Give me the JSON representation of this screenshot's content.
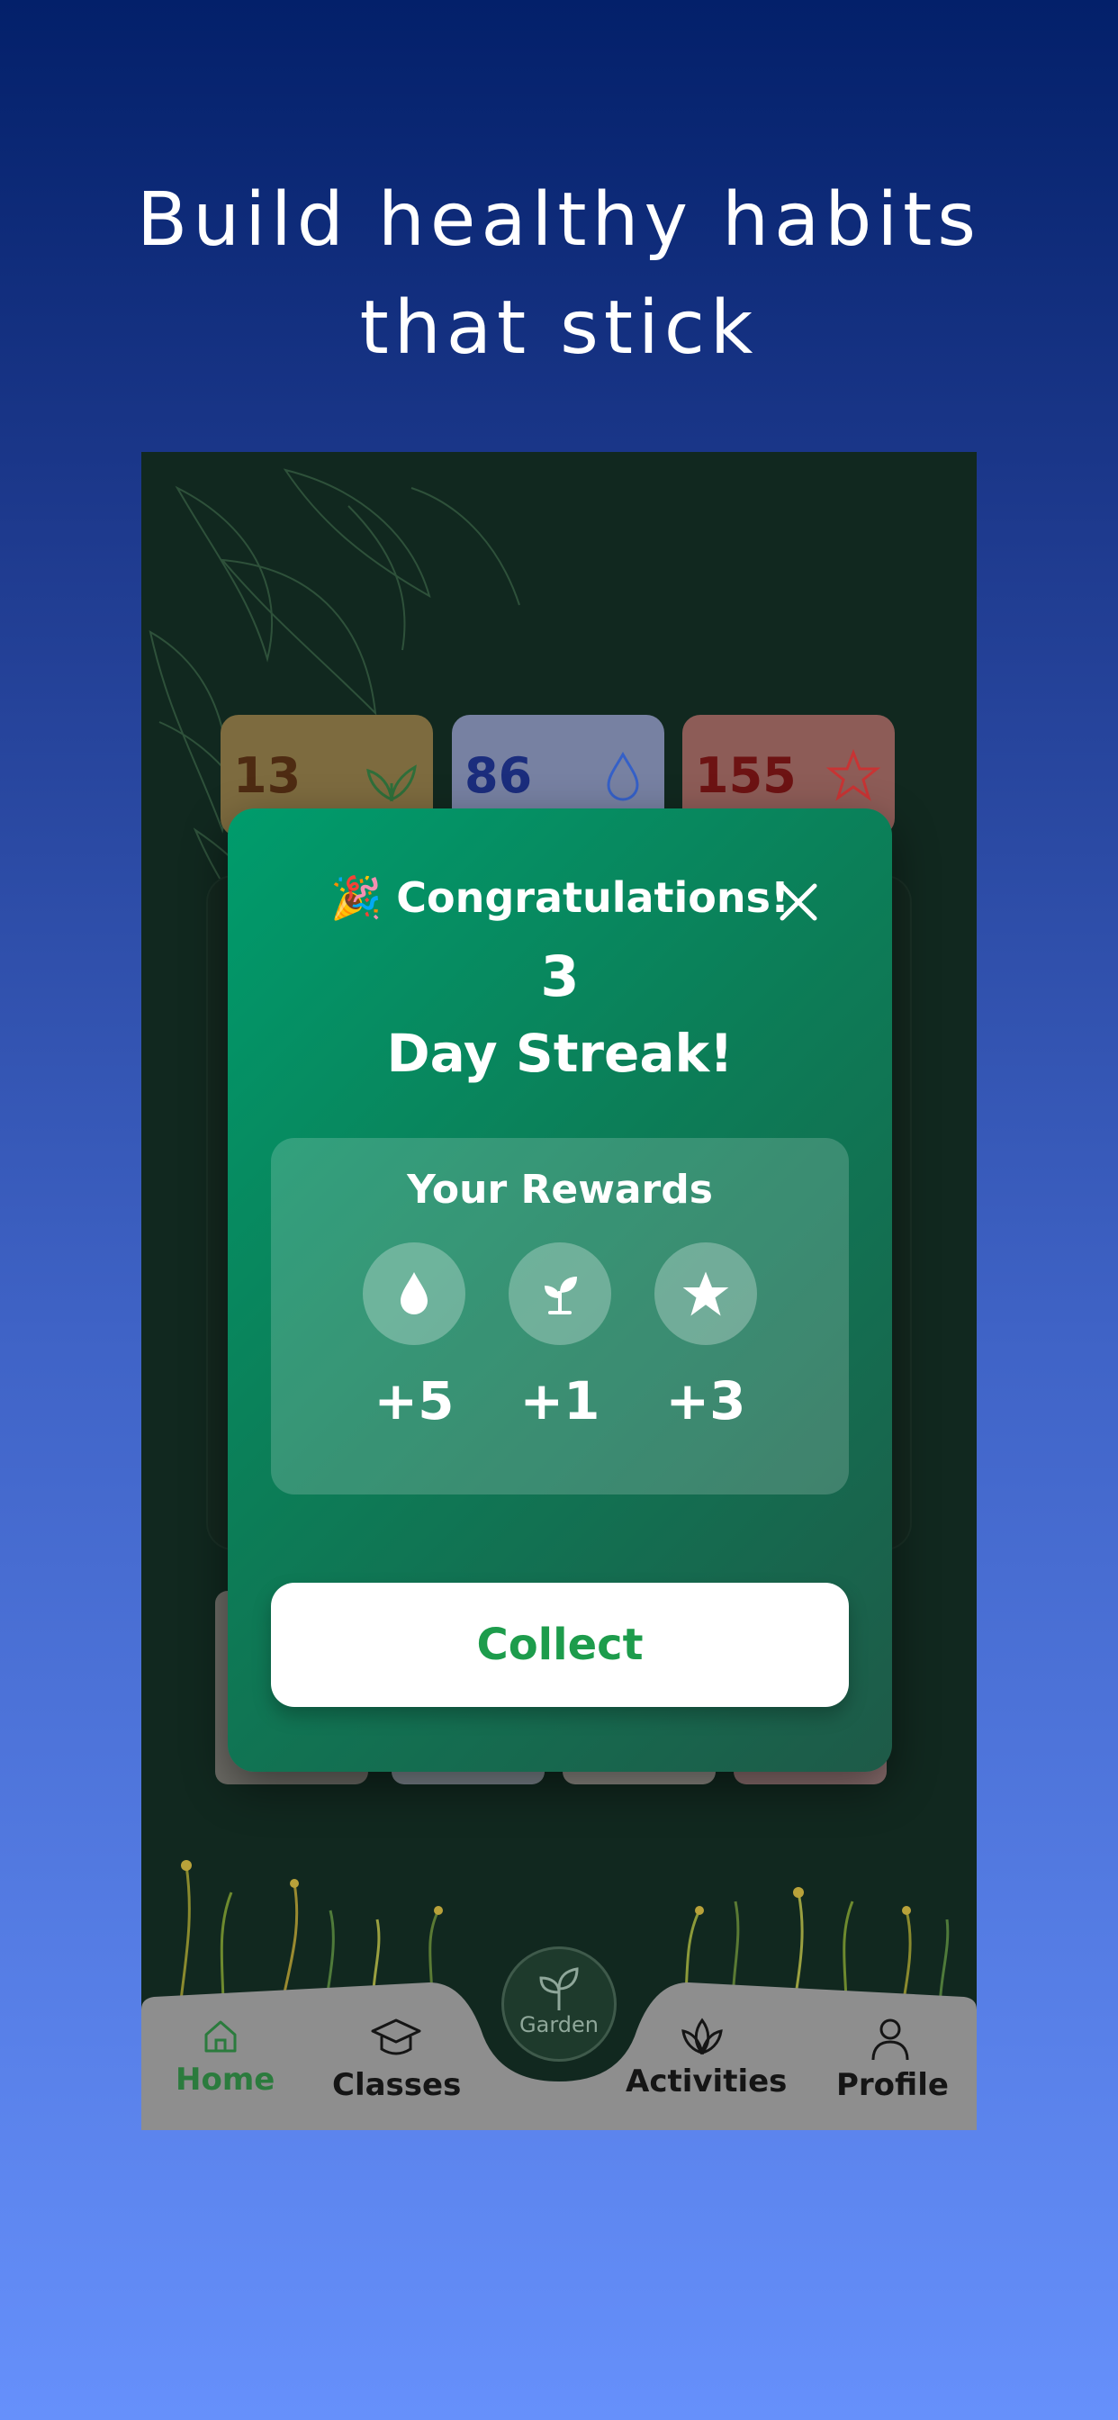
{
  "headline": {
    "line1": "Build healthy habits",
    "line2": "that stick"
  },
  "stats": [
    {
      "value": "13",
      "icon": "leaf-icon"
    },
    {
      "value": "86",
      "icon": "drop-icon"
    },
    {
      "value": "155",
      "icon": "star-icon"
    }
  ],
  "modal": {
    "title": "🎉 Congratulations!",
    "streak_number": "3",
    "streak_text": "Day Streak!",
    "rewards_title": "Your Rewards",
    "rewards": [
      {
        "icon": "drop-icon",
        "value": "+5"
      },
      {
        "icon": "sprout-icon",
        "value": "+1"
      },
      {
        "icon": "star-icon",
        "value": "+3"
      }
    ],
    "collect_label": "Collect"
  },
  "nav": {
    "home": "Home",
    "classes": "Classes",
    "garden": "Garden",
    "activities": "Activities",
    "profile": "Profile"
  },
  "colors": {
    "accent_green": "#1d9c4c",
    "modal_start": "#009c6c",
    "modal_end": "#1e5a48"
  }
}
